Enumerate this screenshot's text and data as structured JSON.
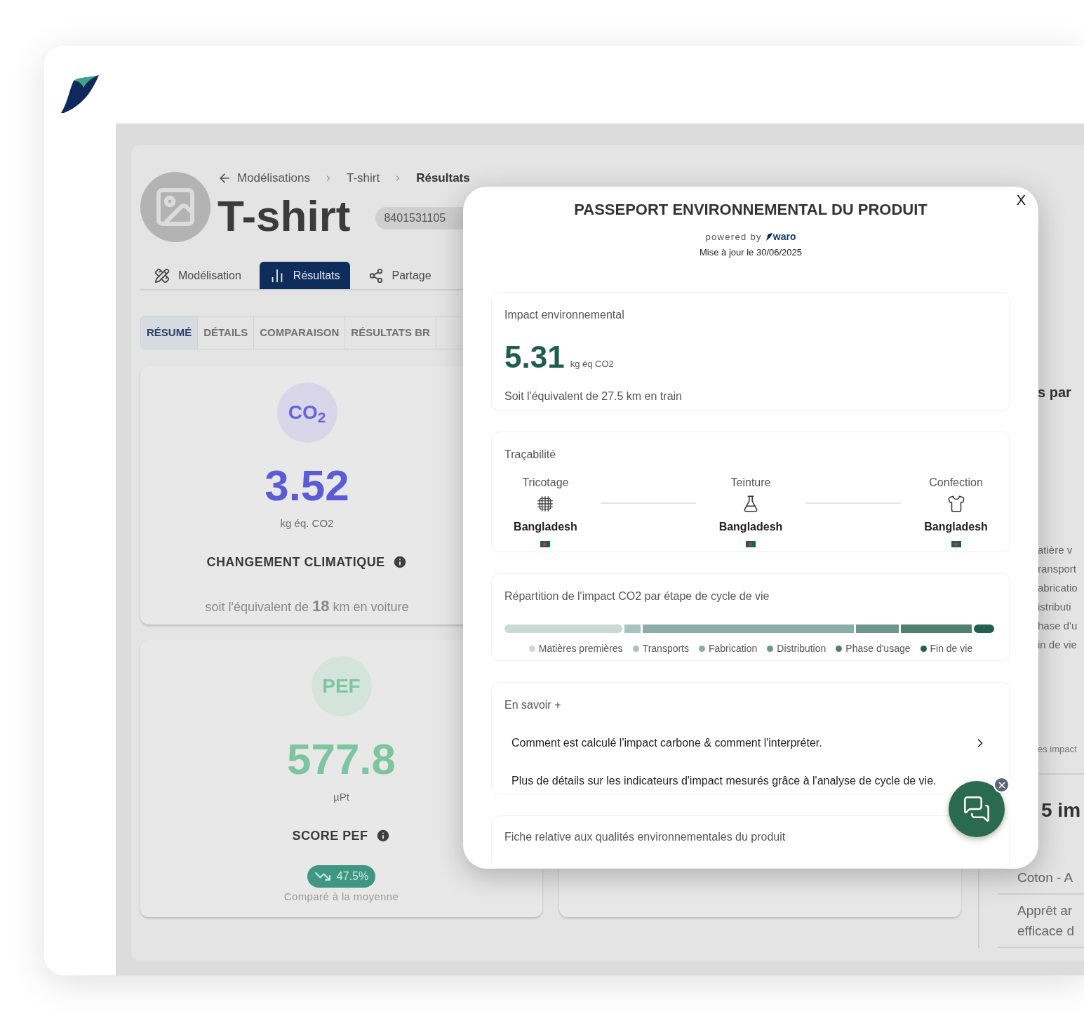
{
  "breadcrumb": [
    {
      "label": "Modélisations",
      "current": false
    },
    {
      "label": "T-shirt",
      "current": false
    },
    {
      "label": "Résultats",
      "current": true
    }
  ],
  "product": {
    "title": "T-shirt",
    "code": "8401531105"
  },
  "nav_tabs": [
    {
      "label": "Modélisation",
      "selected": false
    },
    {
      "label": "Résultats",
      "selected": true
    },
    {
      "label": "Partage",
      "selected": false
    }
  ],
  "sub_tabs": [
    {
      "label": "RÉSUMÉ",
      "selected": true
    },
    {
      "label": "DÉTAILS",
      "selected": false
    },
    {
      "label": "COMPARAISON",
      "selected": false
    },
    {
      "label": "RÉSULTATS BR",
      "selected": false
    }
  ],
  "score_cards": [
    {
      "kind": "co2",
      "badge": "CO$_{2}$",
      "value": "3.52",
      "unit": "kg éq. CO2",
      "label": "CHANGEMENT CLIMATIQUE",
      "note": "soit l'équivalent de **18** km en voiture"
    },
    {
      "kind": "pef",
      "badge": "PEF",
      "value": "577.8",
      "unit": "µPt",
      "label": "SCORE PEF",
      "trend": "47.5%",
      "trend_caption": "Comparé à la moyenne"
    }
  ],
  "side_panel": {
    "heading": "s par",
    "legend": [
      "atière v",
      "ransport",
      "abricatio",
      "istributi",
      "hase d'u",
      "in de vie"
    ],
    "footnote": "es impact",
    "section_title": "5 im",
    "rows": [
      "Coton - A",
      "Apprêt ar efficace d"
    ]
  },
  "passport": {
    "close": "X",
    "title": "PASSEPORT ENVIRONNEMENTAL DU PRODUIT",
    "powered_by": "powered by",
    "brand": "waro",
    "updated": "Mise à jour le 30/06/2025",
    "impact": {
      "title": "Impact environnemental",
      "value": "5.31",
      "unit": "kg éq CO2",
      "equivalent": "Soit l'équivalent de 27.5 km en train"
    },
    "traceability": {
      "title": "Traçabilité",
      "steps": [
        {
          "label": "Tricotage",
          "country": "Bangladesh"
        },
        {
          "label": "Teinture",
          "country": "Bangladesh"
        },
        {
          "label": "Confection",
          "country": "Bangladesh"
        }
      ]
    },
    "breakdown": {
      "title": "Répartition de l'impact CO2 par étape de cycle de vie",
      "stages": [
        {
          "label": "Matières premières",
          "color": "#c9d9d3"
        },
        {
          "label": "Transports",
          "color": "#a9c4bc"
        },
        {
          "label": "Fabrication",
          "color": "#8aada4"
        },
        {
          "label": "Distribution",
          "color": "#6e978b"
        },
        {
          "label": "Phase d'usage",
          "color": "#50806f"
        },
        {
          "label": "Fin de vie",
          "color": "#245f4d"
        }
      ]
    },
    "learn_more": {
      "title": "En savoir +",
      "links": [
        {
          "text": "Comment est calculé l'impact carbone & comment l'interpréter.",
          "chevron": true
        },
        {
          "text": "Plus de détails sur les indicateurs d'impact mesurés grâce à l'analyse de cycle de vie.",
          "chevron": false
        }
      ]
    },
    "sheet": {
      "title": "Fiche relative aux qualités environnementales du produit"
    }
  }
}
